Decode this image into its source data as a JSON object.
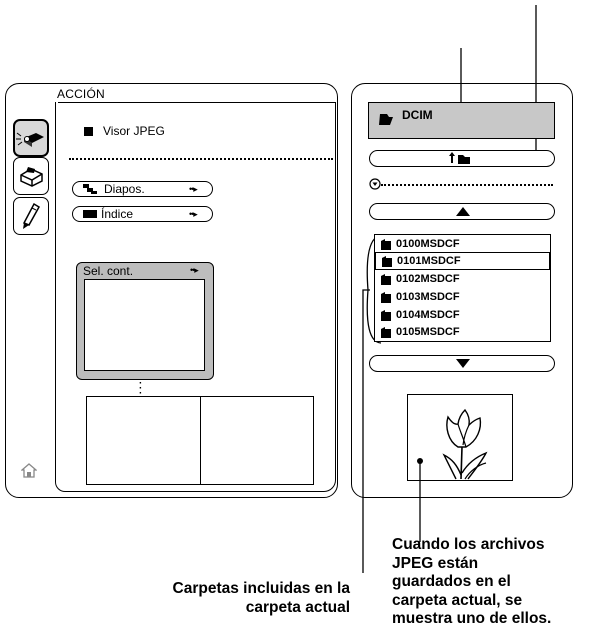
{
  "left_panel": {
    "tab_title": "ACCIÓN",
    "side_tabs": [
      {
        "icon": "projector-icon",
        "selected": true
      },
      {
        "icon": "toolbox-icon",
        "selected": false
      },
      {
        "icon": "pen-icon",
        "selected": false
      }
    ],
    "visor_label": "Visor JPEG",
    "buttons": [
      {
        "label": "Diapos.",
        "icon": "slideshow-icon",
        "arrow": "••▸"
      },
      {
        "label": "Índice",
        "icon": "index-icon",
        "arrow": "••▸"
      }
    ],
    "sel_cont": {
      "label": "Sel. cont.",
      "arrow": "••▸"
    },
    "home_icon": "home-icon"
  },
  "right_panel": {
    "current_folder": "DCIM",
    "up_folder_icon": "up-folder-icon",
    "scroll_up_icon": "up-triangle-icon",
    "scroll_down_icon": "down-triangle-icon",
    "folders": [
      {
        "name": "0100MSDCF",
        "selected": false
      },
      {
        "name": "0101MSDCF",
        "selected": true
      },
      {
        "name": "0102MSDCF",
        "selected": false
      },
      {
        "name": "0103MSDCF",
        "selected": false
      },
      {
        "name": "0104MSDCF",
        "selected": false
      },
      {
        "name": "0105MSDCF",
        "selected": false
      }
    ],
    "preview_icon": "tulip-image"
  },
  "captions": {
    "left": [
      "Carpetas incluidas en la",
      "carpeta actual"
    ],
    "right": [
      "Cuando los archivos",
      "JPEG están",
      "guardados en el",
      "carpeta actual, se",
      "muestra uno de ellos."
    ]
  }
}
